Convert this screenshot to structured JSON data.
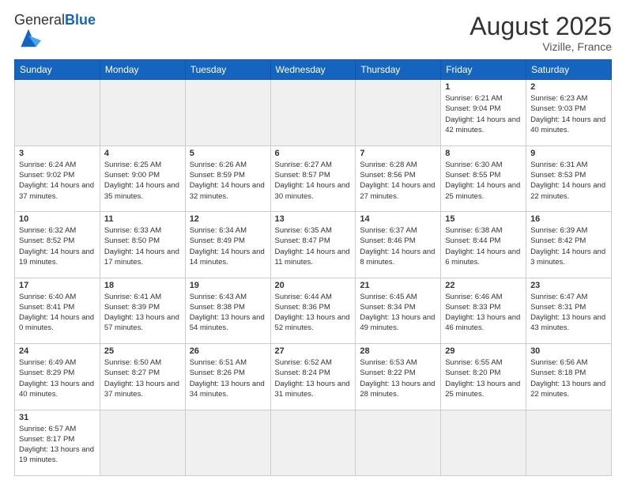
{
  "header": {
    "logo_general": "General",
    "logo_blue": "Blue",
    "month_year": "August 2025",
    "location": "Vizille, France"
  },
  "weekdays": [
    "Sunday",
    "Monday",
    "Tuesday",
    "Wednesday",
    "Thursday",
    "Friday",
    "Saturday"
  ],
  "weeks": [
    [
      {
        "day": "",
        "empty": true
      },
      {
        "day": "",
        "empty": true
      },
      {
        "day": "",
        "empty": true
      },
      {
        "day": "",
        "empty": true
      },
      {
        "day": "",
        "empty": true
      },
      {
        "day": "1",
        "sunrise": "6:21 AM",
        "sunset": "9:04 PM",
        "daylight": "14 hours and 42 minutes."
      },
      {
        "day": "2",
        "sunrise": "6:23 AM",
        "sunset": "9:03 PM",
        "daylight": "14 hours and 40 minutes."
      }
    ],
    [
      {
        "day": "3",
        "sunrise": "6:24 AM",
        "sunset": "9:02 PM",
        "daylight": "14 hours and 37 minutes."
      },
      {
        "day": "4",
        "sunrise": "6:25 AM",
        "sunset": "9:00 PM",
        "daylight": "14 hours and 35 minutes."
      },
      {
        "day": "5",
        "sunrise": "6:26 AM",
        "sunset": "8:59 PM",
        "daylight": "14 hours and 32 minutes."
      },
      {
        "day": "6",
        "sunrise": "6:27 AM",
        "sunset": "8:57 PM",
        "daylight": "14 hours and 30 minutes."
      },
      {
        "day": "7",
        "sunrise": "6:28 AM",
        "sunset": "8:56 PM",
        "daylight": "14 hours and 27 minutes."
      },
      {
        "day": "8",
        "sunrise": "6:30 AM",
        "sunset": "8:55 PM",
        "daylight": "14 hours and 25 minutes."
      },
      {
        "day": "9",
        "sunrise": "6:31 AM",
        "sunset": "8:53 PM",
        "daylight": "14 hours and 22 minutes."
      }
    ],
    [
      {
        "day": "10",
        "sunrise": "6:32 AM",
        "sunset": "8:52 PM",
        "daylight": "14 hours and 19 minutes."
      },
      {
        "day": "11",
        "sunrise": "6:33 AM",
        "sunset": "8:50 PM",
        "daylight": "14 hours and 17 minutes."
      },
      {
        "day": "12",
        "sunrise": "6:34 AM",
        "sunset": "8:49 PM",
        "daylight": "14 hours and 14 minutes."
      },
      {
        "day": "13",
        "sunrise": "6:35 AM",
        "sunset": "8:47 PM",
        "daylight": "14 hours and 11 minutes."
      },
      {
        "day": "14",
        "sunrise": "6:37 AM",
        "sunset": "8:46 PM",
        "daylight": "14 hours and 8 minutes."
      },
      {
        "day": "15",
        "sunrise": "6:38 AM",
        "sunset": "8:44 PM",
        "daylight": "14 hours and 6 minutes."
      },
      {
        "day": "16",
        "sunrise": "6:39 AM",
        "sunset": "8:42 PM",
        "daylight": "14 hours and 3 minutes."
      }
    ],
    [
      {
        "day": "17",
        "sunrise": "6:40 AM",
        "sunset": "8:41 PM",
        "daylight": "14 hours and 0 minutes."
      },
      {
        "day": "18",
        "sunrise": "6:41 AM",
        "sunset": "8:39 PM",
        "daylight": "13 hours and 57 minutes."
      },
      {
        "day": "19",
        "sunrise": "6:43 AM",
        "sunset": "8:38 PM",
        "daylight": "13 hours and 54 minutes."
      },
      {
        "day": "20",
        "sunrise": "6:44 AM",
        "sunset": "8:36 PM",
        "daylight": "13 hours and 52 minutes."
      },
      {
        "day": "21",
        "sunrise": "6:45 AM",
        "sunset": "8:34 PM",
        "daylight": "13 hours and 49 minutes."
      },
      {
        "day": "22",
        "sunrise": "6:46 AM",
        "sunset": "8:33 PM",
        "daylight": "13 hours and 46 minutes."
      },
      {
        "day": "23",
        "sunrise": "6:47 AM",
        "sunset": "8:31 PM",
        "daylight": "13 hours and 43 minutes."
      }
    ],
    [
      {
        "day": "24",
        "sunrise": "6:49 AM",
        "sunset": "8:29 PM",
        "daylight": "13 hours and 40 minutes."
      },
      {
        "day": "25",
        "sunrise": "6:50 AM",
        "sunset": "8:27 PM",
        "daylight": "13 hours and 37 minutes."
      },
      {
        "day": "26",
        "sunrise": "6:51 AM",
        "sunset": "8:26 PM",
        "daylight": "13 hours and 34 minutes."
      },
      {
        "day": "27",
        "sunrise": "6:52 AM",
        "sunset": "8:24 PM",
        "daylight": "13 hours and 31 minutes."
      },
      {
        "day": "28",
        "sunrise": "6:53 AM",
        "sunset": "8:22 PM",
        "daylight": "13 hours and 28 minutes."
      },
      {
        "day": "29",
        "sunrise": "6:55 AM",
        "sunset": "8:20 PM",
        "daylight": "13 hours and 25 minutes."
      },
      {
        "day": "30",
        "sunrise": "6:56 AM",
        "sunset": "8:18 PM",
        "daylight": "13 hours and 22 minutes."
      }
    ],
    [
      {
        "day": "31",
        "sunrise": "6:57 AM",
        "sunset": "8:17 PM",
        "daylight": "13 hours and 19 minutes.",
        "last": true
      },
      {
        "day": "",
        "empty": true,
        "last": true
      },
      {
        "day": "",
        "empty": true,
        "last": true
      },
      {
        "day": "",
        "empty": true,
        "last": true
      },
      {
        "day": "",
        "empty": true,
        "last": true
      },
      {
        "day": "",
        "empty": true,
        "last": true
      },
      {
        "day": "",
        "empty": true,
        "last": true
      }
    ]
  ]
}
